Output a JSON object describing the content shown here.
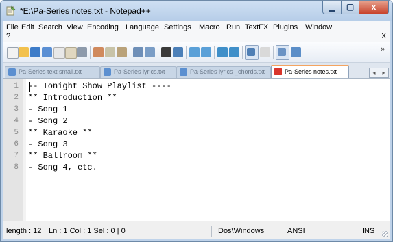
{
  "window": {
    "title": "*E:\\Pa-Series notes.txt - Notepad++",
    "controls": {
      "minimize_icon": "minimize-icon",
      "maximize_icon": "maximize-icon",
      "close_label": "x"
    }
  },
  "menu": {
    "items": [
      "File",
      "Edit",
      "Search",
      "View",
      "Encoding",
      "Language",
      "Settings",
      "Macro",
      "Run",
      "TextFX",
      "Plugins",
      "Window",
      "?"
    ],
    "close_doc": "X"
  },
  "toolbar": {
    "icons": [
      "new-file-icon",
      "open-file-icon",
      "save-icon",
      "save-all-icon",
      "close-icon",
      "close-all-icon",
      "print-icon",
      "cut-icon",
      "copy-icon",
      "paste-icon",
      "undo-icon",
      "redo-icon",
      "find-icon",
      "replace-icon",
      "zoom-in-icon",
      "zoom-out-icon",
      "sync-vertical-icon",
      "sync-horizontal-icon",
      "word-wrap-icon",
      "show-all-chars-icon",
      "indent-guide-icon",
      "user-language-icon"
    ],
    "more": "»"
  },
  "tabs": [
    {
      "label": "Pa-Series text small.txt",
      "active": false
    },
    {
      "label": "Pa-Series lyrics.txt",
      "active": false
    },
    {
      "label": "Pa-Series lyrics _chords.txt",
      "active": false
    },
    {
      "label": "Pa-Series notes.txt",
      "active": true
    }
  ],
  "tab_scroll": {
    "left": "◂",
    "right": "▸"
  },
  "editor": {
    "line_numbers": [
      "1",
      "2",
      "3",
      "4",
      "5",
      "6",
      "7",
      "8"
    ],
    "lines": [
      "-- Tonight Show Playlist ----",
      "** Introduction **",
      "- Song 1",
      "- Song 2",
      "** Karaoke **",
      "- Song 3",
      "** Ballroom **",
      "- Song 4, etc."
    ]
  },
  "status": {
    "length": "length : 12",
    "position": "Ln : 1    Col : 1    Sel : 0 | 0",
    "eol": "Dos\\Windows",
    "encoding": "ANSI",
    "mode": "INS"
  },
  "colors": {
    "tab_active_accent": "#f4a460",
    "close_button": "#c7412b",
    "title_bar": "#bfd3ea",
    "gutter": "#e4e4e4"
  }
}
